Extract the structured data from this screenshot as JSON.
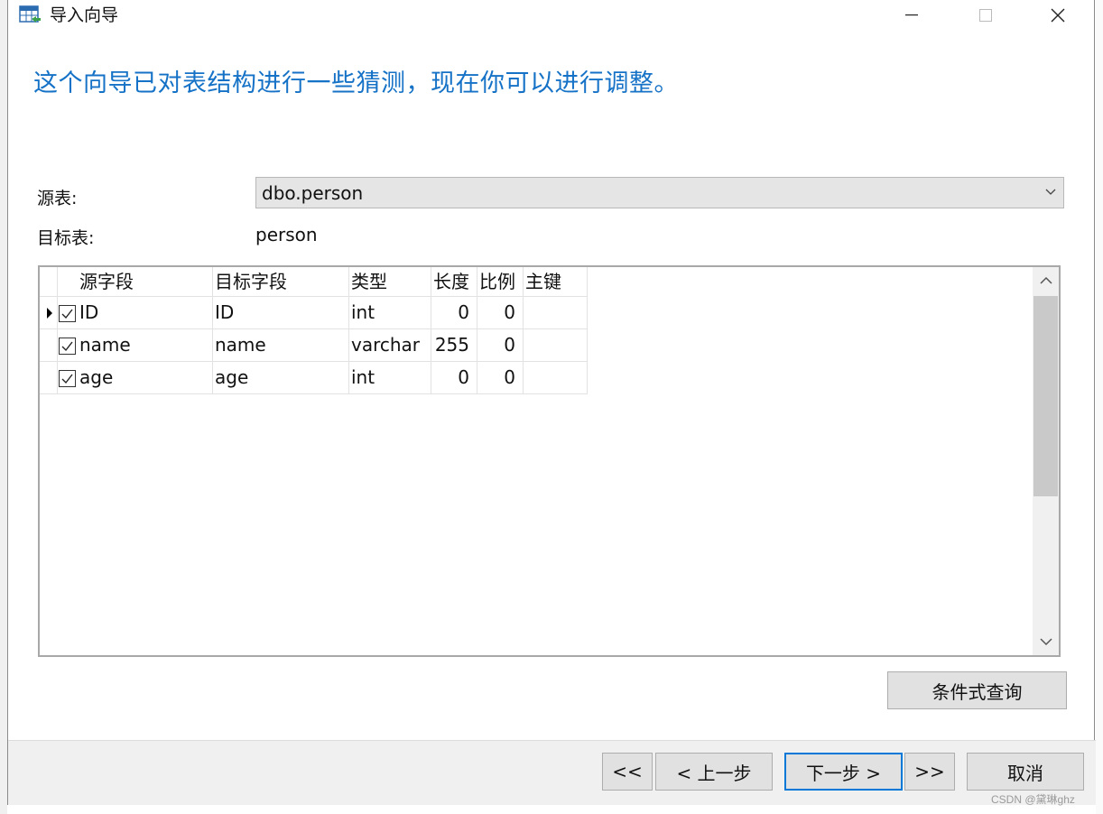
{
  "window": {
    "title": "导入向导",
    "icon": "import-table-icon"
  },
  "heading": "这个向导已对表结构进行一些猜测，现在你可以进行调整。",
  "source": {
    "label": "源表:",
    "value": "dbo.person"
  },
  "target": {
    "label": "目标表:",
    "value": "person"
  },
  "grid": {
    "columns": [
      "源字段",
      "目标字段",
      "类型",
      "长度",
      "比例",
      "主键"
    ],
    "rows": [
      {
        "checked": true,
        "current": true,
        "src": "ID",
        "dst": "ID",
        "type": "int",
        "length": "0",
        "scale": "0",
        "pk": ""
      },
      {
        "checked": true,
        "current": false,
        "src": "name",
        "dst": "name",
        "type": "varchar",
        "length": "255",
        "scale": "0",
        "pk": ""
      },
      {
        "checked": true,
        "current": false,
        "src": "age",
        "dst": "age",
        "type": "int",
        "length": "0",
        "scale": "0",
        "pk": ""
      }
    ]
  },
  "buttons": {
    "condition_query": "条件式查询",
    "first": "<<",
    "prev": "< 上一步",
    "next": "下一步 >",
    "last": ">>",
    "cancel": "取消"
  },
  "watermark": "CSDN @黛琳ghz",
  "colors": {
    "heading": "#1572c6",
    "focus_border": "#0078d7"
  }
}
